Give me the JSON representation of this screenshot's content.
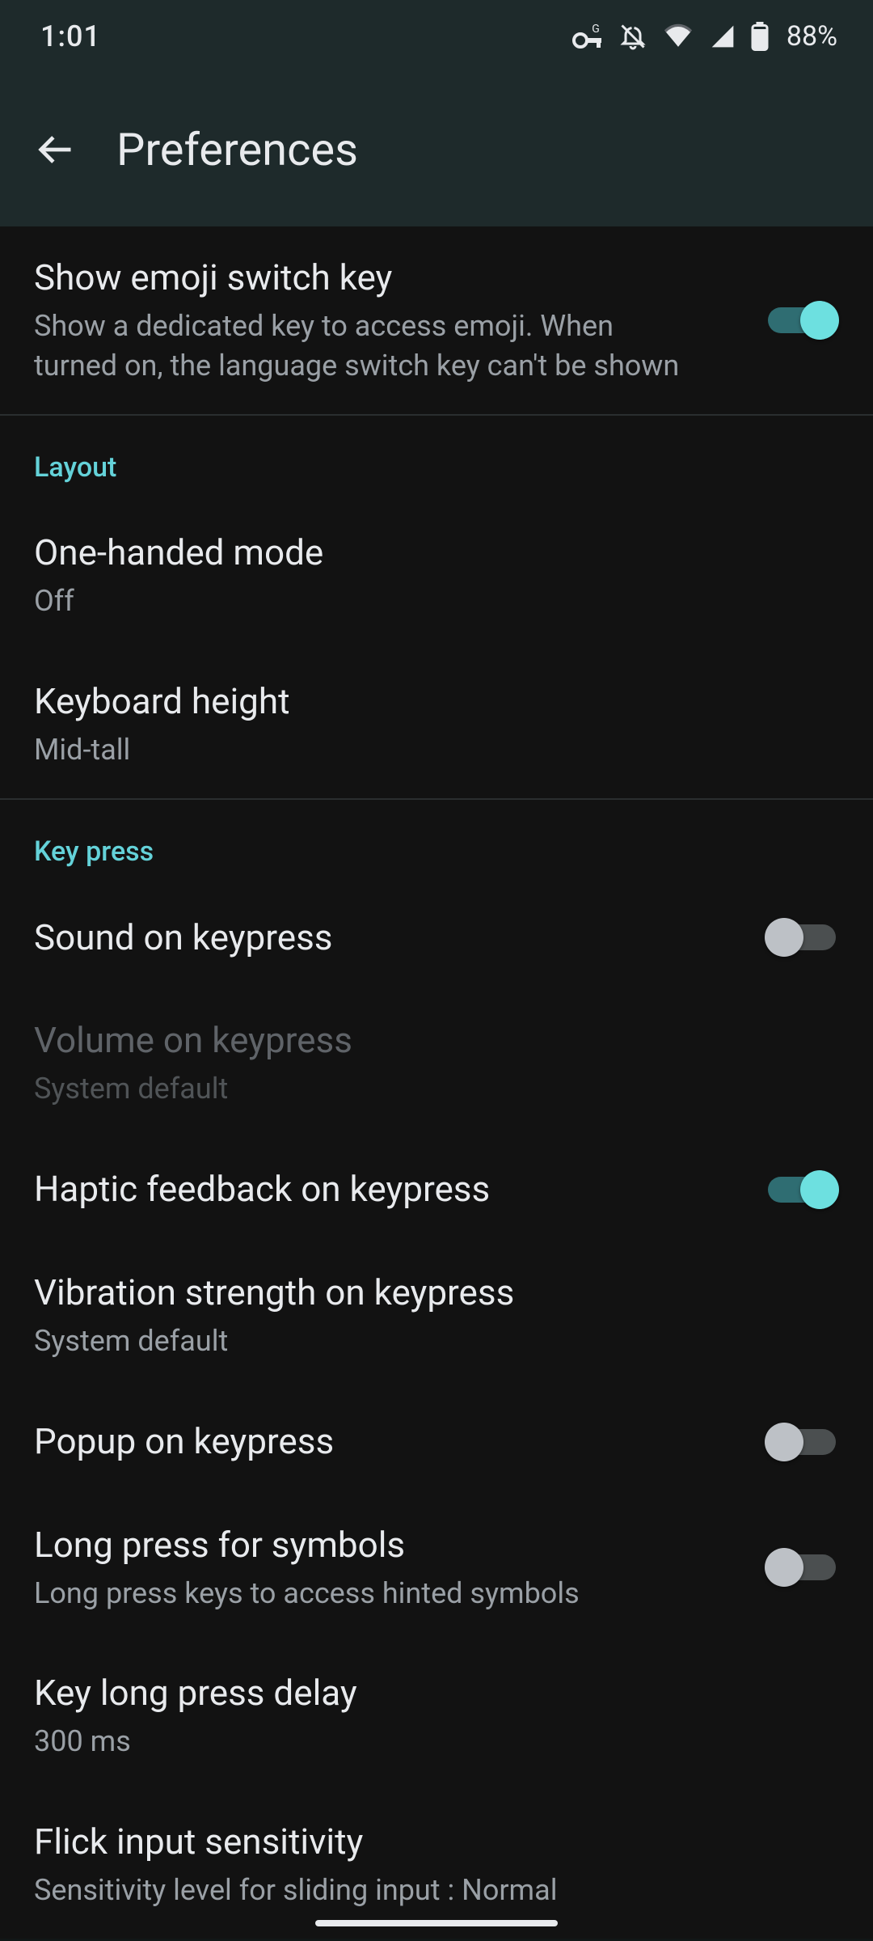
{
  "status": {
    "time": "1:01",
    "battery": "88%"
  },
  "header": {
    "title": "Preferences"
  },
  "sections": {
    "top": {
      "emoji": {
        "title": "Show emoji switch key",
        "sub": "Show a dedicated key to access emoji. When turned on, the language switch key can't be shown",
        "on": true
      }
    },
    "layout": {
      "label": "Layout",
      "one_handed": {
        "title": "One-handed mode",
        "sub": "Off"
      },
      "kb_height": {
        "title": "Keyboard height",
        "sub": "Mid-tall"
      }
    },
    "keypress": {
      "label": "Key press",
      "sound": {
        "title": "Sound on keypress",
        "on": false
      },
      "volume": {
        "title": "Volume on keypress",
        "sub": "System default",
        "enabled": false
      },
      "haptic": {
        "title": "Haptic feedback on keypress",
        "on": true
      },
      "vibration": {
        "title": "Vibration strength on keypress",
        "sub": "System default"
      },
      "popup": {
        "title": "Popup on keypress",
        "on": false
      },
      "longpress_symbols": {
        "title": "Long press for symbols",
        "sub": "Long press keys to access hinted symbols",
        "on": false
      },
      "longpress_delay": {
        "title": "Key long press delay",
        "sub": "300 ms"
      },
      "flick": {
        "title": "Flick input sensitivity",
        "sub": "Sensitivity level for sliding input : Normal"
      }
    }
  }
}
